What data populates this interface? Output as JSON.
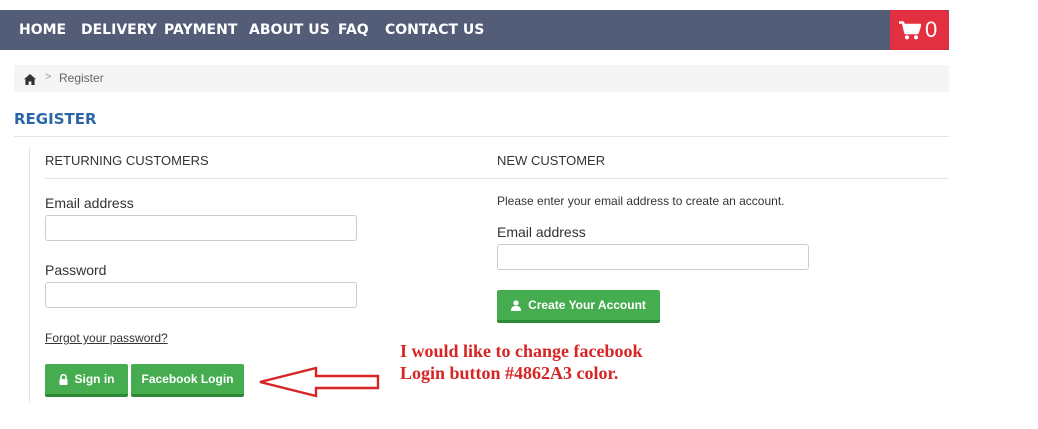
{
  "nav": {
    "items": [
      "HOME",
      "DELIVERY",
      "PAYMENT",
      "ABOUT US",
      "FAQ",
      "CONTACT US"
    ],
    "cart_count": "0",
    "cart_icon": "shopping-cart-icon"
  },
  "breadcrumb": {
    "home_icon": "home-icon",
    "separator": ">",
    "current": "Register"
  },
  "page": {
    "title": "REGISTER"
  },
  "returning": {
    "heading": "RETURNING CUSTOMERS",
    "email_label": "Email address",
    "email_value": "",
    "password_label": "Password",
    "password_value": "",
    "forgot_link": "Forgot your password?",
    "signin_label": "Sign in",
    "facebook_label": "Facebook Login"
  },
  "new_customer": {
    "heading": "NEW CUSTOMER",
    "intro": "Please enter your email address to create an account.",
    "email_label": "Email address",
    "email_value": "",
    "create_label": "Create Your Account"
  },
  "annotation": {
    "line1": "I would like to change facebook",
    "line2": "Login button #4862A3 color."
  },
  "colors": {
    "navbar": "#545d78",
    "cart": "#e33041",
    "button_green": "#45ac4f",
    "title_blue": "#2a66a8",
    "annotation_red": "#d72424"
  }
}
